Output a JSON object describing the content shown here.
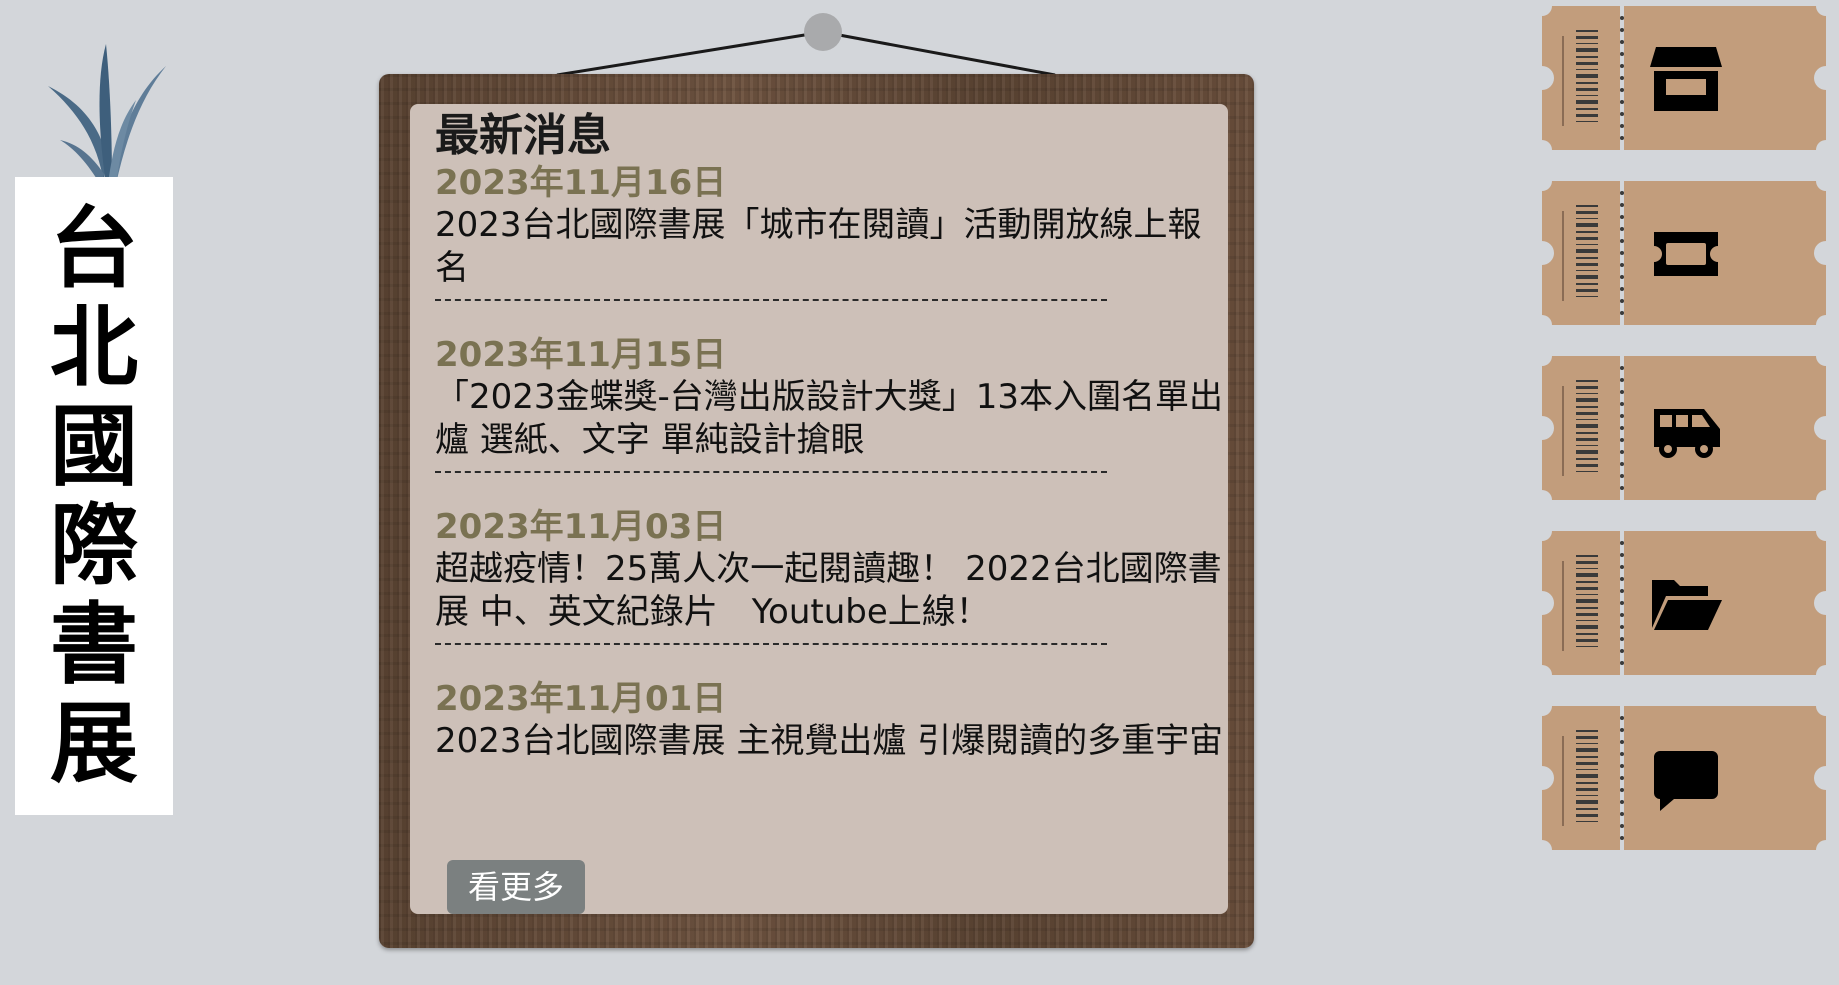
{
  "banner": {
    "chars": [
      "台",
      "北",
      "國",
      "際",
      "書",
      "展"
    ]
  },
  "news": {
    "title": "最新消息",
    "items": [
      {
        "date": "2023年11月16日",
        "text": "2023台北國際書展「城市在閱讀」活動開放線上報名"
      },
      {
        "date": "2023年11月15日",
        "text": "「2023金蝶獎-台灣出版設計大獎」13本入圍名單出爐 選紙、文字 單純設計搶眼"
      },
      {
        "date": "2023年11月03日",
        "text": "超越疫情！25萬人次一起閱讀趣！ 2022台北國際書展 中、英文紀錄片　Youtube上線！"
      },
      {
        "date": "2023年11月01日",
        "text": "2023台北國際書展 主視覺出爐 引爆閱讀的多重宇宙"
      }
    ],
    "more_label": "看更多"
  },
  "tickets": [
    {
      "icon": "store-icon"
    },
    {
      "icon": "ticket-icon"
    },
    {
      "icon": "bus-icon"
    },
    {
      "icon": "folder-open-icon"
    },
    {
      "icon": "message-icon"
    }
  ],
  "colors": {
    "background": "#d3d6da",
    "paper": "#cdc0b8",
    "date_text": "#7a7252",
    "ticket": "#c29d7c",
    "more_button": "#7b8080"
  }
}
